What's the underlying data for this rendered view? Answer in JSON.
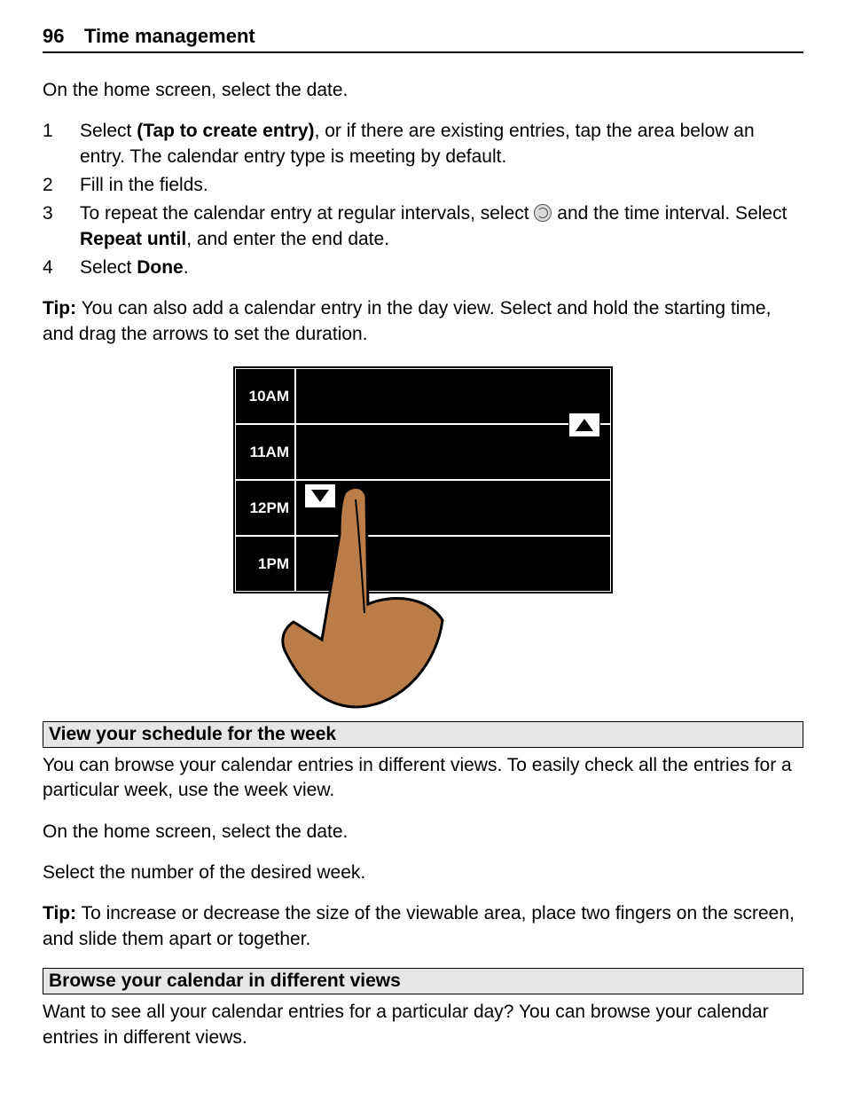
{
  "header": {
    "page_number": "96",
    "title": "Time management"
  },
  "intro": "On the home screen, select the date.",
  "steps": [
    {
      "num": "1",
      "pre": "Select ",
      "bold1": "(Tap to create entry)",
      "post": ", or if there are existing entries, tap the area below an entry. The calendar entry type is meeting by default."
    },
    {
      "num": "2",
      "text": "Fill in the fields."
    },
    {
      "num": "3",
      "pre": "To repeat the calendar entry at regular intervals, select ",
      "post_icon": " and the time interval. Select ",
      "bold_mid": "Repeat until",
      "tail": ", and enter the end date."
    },
    {
      "num": "4",
      "pre": "Select ",
      "bold1": "Done",
      "post": "."
    }
  ],
  "tip1": {
    "label": "Tip:",
    "text": " You can also add a calendar entry in the day view. Select and hold the starting time, and drag the arrows to set the duration."
  },
  "figure": {
    "times": [
      "10AM",
      "11AM",
      "12PM",
      "1PM"
    ]
  },
  "section_week": {
    "heading": "View your schedule for the week",
    "p1": "You can browse your calendar entries in different views. To easily check all the entries for a particular week, use the week view.",
    "p2": "On the home screen, select the date.",
    "p3": "Select the number of the desired week.",
    "tip": {
      "label": "Tip:",
      "text": " To increase or decrease the size of the viewable area, place two fingers on the screen, and slide them apart or together."
    }
  },
  "section_browse": {
    "heading": "Browse your calendar in different views",
    "p1": "Want to see all your calendar entries for a particular day? You can browse your calendar entries in different views."
  }
}
